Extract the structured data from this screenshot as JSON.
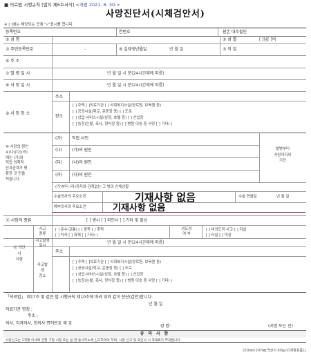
{
  "header": {
    "form_ref": "■ 의료법 시행규칙 [별지 제6호서식]",
    "revision": "<개정 2021. 6. 30.>",
    "title": "사망진단서(시체검안서)",
    "note": "※ [ ]에는 해당되는 곳에 \"√\"표시를 합니다."
  },
  "rows": {
    "reg_no": "등록번호",
    "serial_no": "연번호",
    "original": "원본 대조필인",
    "name": "① 성      명",
    "sex": "② 성 별",
    "sex_opts": "[  ]남[  ]여",
    "rrn": "③ 주민등록번호",
    "rrn_dash": "-",
    "birth": "④ 실제생년월일",
    "ymd": "년   월   일",
    "job": "⑤ 직 업",
    "address": "⑥ 주      소",
    "time_occur": "⑦ 발 병 일 시",
    "time_death": "⑧ 사 망 일 시",
    "datetime": "년    월    일    시    분(24시간제에 따름)",
    "place": "⑨ 사 망 장 소",
    "addr_short": "주소",
    "place_short": "장소"
  },
  "place_options": [
    "[  ] 주택        [  ]의료기관          [  ] 사회복지시설(양로원, 보육원 등)",
    "[  ] 공공시설(학교, 운동장 등)        [  ] 도로",
    "[  ] 상업·서비스시설(상점, 호텔 등)    [  ] 산업장",
    "[  ] 농장(논밭, 축사, 양식장 등)       [  ] 병원 이송 중 사망   [  ] 기타(          )"
  ],
  "cause": {
    "label_lines": [
      "⑩ 사망의 원인",
      "※(나)(다)(라)",
      "에는 (가)와",
      "직접 의학적",
      "인과관계가 명",
      "확한 것 만을",
      "적습니다."
    ],
    "rows": [
      {
        "tag": "(가)",
        "text": "직접 사인"
      },
      {
        "tag": "(나)",
        "text": "(가)의 원인"
      },
      {
        "tag": "(다)",
        "text": "(나)의 원인"
      },
      {
        "tag": "(라)",
        "text": "(다)의 원인"
      }
    ],
    "duration_label": [
      "발병부터",
      "사망까지의",
      "기간"
    ],
    "other_label": "(가)부터 (라)까지와 관계없는 그 밖의 신체상황",
    "surgery": "수술의사의 주요소견",
    "surgery_date": "수술 연월일",
    "surgery_ymd": "년    월    일",
    "autopsy": "해부의사의 주요소견",
    "stamp1": "기재사항 없음",
    "stamp2": "기재사항 없음"
  },
  "kind": {
    "label": "⑪ 사망의 종류",
    "options": "[  ] 병사          [  ] 외인사          [  ] 기타 및 불상"
  },
  "external": {
    "label_lines": [
      "⑫ 외인",
      "사",
      "사항"
    ],
    "accident_kind": [
      "사고",
      "종류"
    ],
    "kind_opts_1": "[  ] 운수(교통)  [  ] 중독  [  ] 추락",
    "kind_opts_2": "[  ] 익사          [  ] 화재  [  ] 기타(          )",
    "intent_label": [
      "의도성",
      "여    부"
    ],
    "intent_1": "[  ] 비의도적 사고   [  ] 자살",
    "intent_2": "[  ] 타살                 [  ] 미상",
    "accident_time": [
      "사고발생",
      "일시"
    ],
    "accident_place": [
      "사고발",
      "생",
      "장소"
    ]
  },
  "statement": "「의료법」 제17조 및 같은 법 시행규칙 제10조에 따라 위와 같이 진단(검안)합니다.",
  "sign": {
    "date": "년    월    일",
    "institution": "의료기관 명칭 :",
    "address": "주소 :",
    "license": "의사, 치과의사, 한의사 면허번호  제        호",
    "signature": "성 명:",
    "sign_note": "(서명 또는 인)"
  },
  "notice": {
    "title": "유 의 사 항",
    "text": "사망신고는 1개월 이내에 관할 구청·시청 또는 읍·면·동사무소에 신고하여야 하며, 사망 신고 및 외인사 시 과태료가 부과됩니다."
  },
  "paper": "210㎜×297㎜[백상지 80g/㎡(재활용품)]"
}
